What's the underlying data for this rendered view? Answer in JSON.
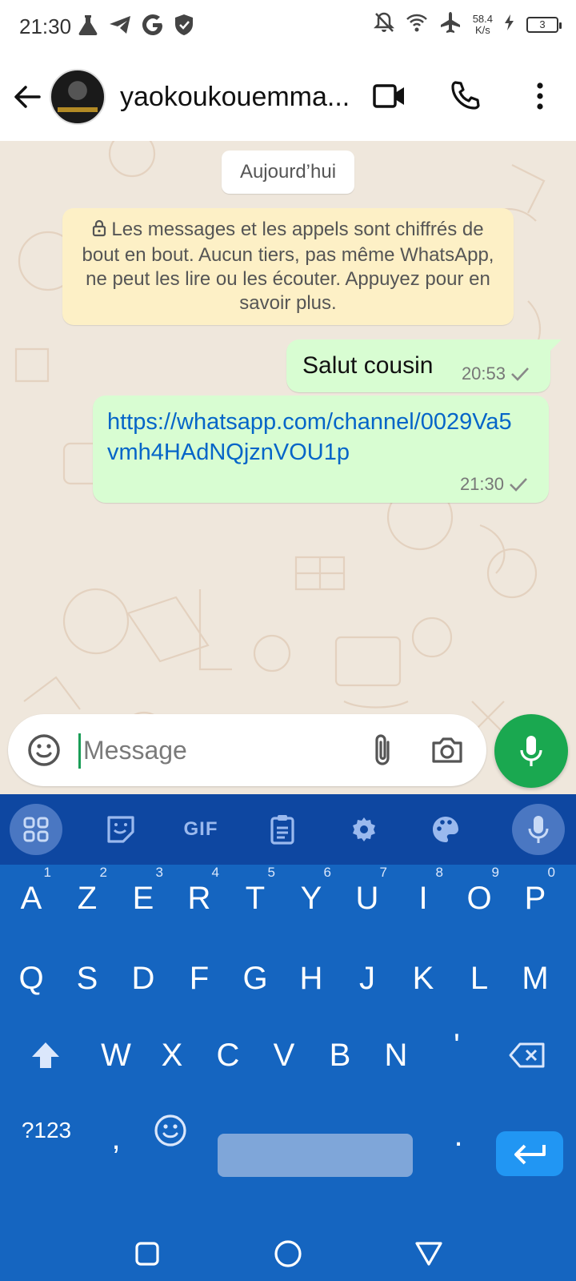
{
  "status_bar": {
    "time": "21:30",
    "speed_value": "58.4",
    "speed_unit": "K/s",
    "battery": "3",
    "icons": [
      "flask-icon",
      "telegram-icon",
      "google-icon",
      "shield-icon",
      "bell-off-icon",
      "wifi-icon",
      "airplane-icon",
      "charging-icon"
    ]
  },
  "header": {
    "contact_name": "yaokoukouemma..."
  },
  "chat": {
    "date_label": "Aujourd’hui",
    "encryption_notice": "Les messages et les appels sont chiffrés de bout en bout. Aucun tiers, pas même WhatsApp, ne peut les lire ou les écouter. Appuyez pour en savoir plus.",
    "messages": [
      {
        "text": "Salut cousin",
        "time": "20:53",
        "status": "sent"
      },
      {
        "text": "https://whatsapp.com/channel/0029Va5vmh4HAdNQjznVOU1p",
        "time": "21:30",
        "status": "sent"
      }
    ]
  },
  "composer": {
    "placeholder": "Message"
  },
  "keyboard": {
    "toolbar": {
      "gif": "GIF"
    },
    "row1": [
      {
        "key": "A",
        "hint": "1"
      },
      {
        "key": "Z",
        "hint": "2"
      },
      {
        "key": "E",
        "hint": "3"
      },
      {
        "key": "R",
        "hint": "4"
      },
      {
        "key": "T",
        "hint": "5"
      },
      {
        "key": "Y",
        "hint": "6"
      },
      {
        "key": "U",
        "hint": "7"
      },
      {
        "key": "I",
        "hint": "8"
      },
      {
        "key": "O",
        "hint": "9"
      },
      {
        "key": "P",
        "hint": "0"
      }
    ],
    "row2": [
      "Q",
      "S",
      "D",
      "F",
      "G",
      "H",
      "J",
      "K",
      "L",
      "M"
    ],
    "row3": [
      "W",
      "X",
      "C",
      "V",
      "B",
      "N",
      "'"
    ],
    "symbols_key": "?123",
    "comma_key": ",",
    "period_key": "."
  },
  "colors": {
    "accent_green": "#1aa850",
    "outgoing_bubble": "#d8fdd2",
    "notice_bg": "#fdf0c6",
    "link": "#0565c8",
    "keyboard_bg": "#1565c0"
  }
}
